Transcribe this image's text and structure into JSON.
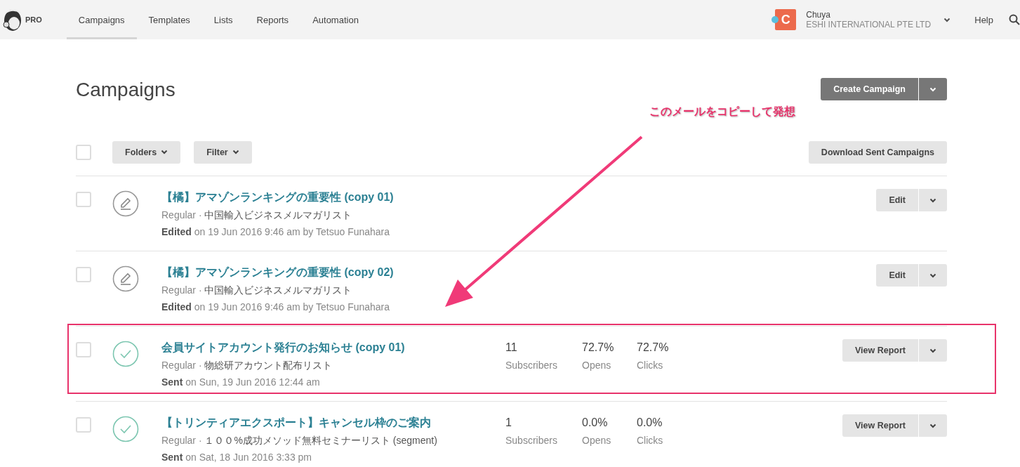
{
  "nav": {
    "badge": "PRO",
    "tabs": [
      {
        "label": "Campaigns",
        "selected": true
      },
      {
        "label": "Templates",
        "selected": false
      },
      {
        "label": "Lists",
        "selected": false
      },
      {
        "label": "Reports",
        "selected": false
      },
      {
        "label": "Automation",
        "selected": false
      }
    ],
    "account": {
      "initial": "C",
      "name": "Chuya",
      "company": "ESHI INTERNATIONAL PTE LTD"
    },
    "help": "Help"
  },
  "page": {
    "title": "Campaigns",
    "create_button": "Create Campaign",
    "select_all": {
      "checked": false
    },
    "folders": "Folders",
    "filter": "Filter",
    "download": "Download Sent Campaigns"
  },
  "campaigns": [
    {
      "kind": "draft",
      "checked": false,
      "highlighted": false,
      "title": "【橘】アマゾンランキングの重要性 (copy 01)",
      "type": "Regular ·",
      "list": "中国輸入ビジネスメルマガリスト",
      "status": "Edited",
      "detail": "on 19 Jun 2016 9:46 am by Tetsuo Funahara",
      "button": "Edit"
    },
    {
      "kind": "draft",
      "checked": false,
      "highlighted": false,
      "title": "【橘】アマゾンランキングの重要性 (copy 02)",
      "type": "Regular ·",
      "list": "中国輸入ビジネスメルマガリスト",
      "status": "Edited",
      "detail": "on 19 Jun 2016 9:46 am by Tetsuo Funahara",
      "button": "Edit"
    },
    {
      "kind": "sent",
      "checked": false,
      "highlighted": true,
      "title": "会員サイトアカウント発行のお知らせ (copy 01)",
      "type": "Regular ·",
      "list": "物総研アカウント配布リスト",
      "status": "Sent",
      "detail": "on Sun, 19 Jun 2016 12:44 am",
      "stats": [
        {
          "value": "11",
          "label": "Subscribers"
        },
        {
          "value": "72.7%",
          "label": "Opens"
        },
        {
          "value": "72.7%",
          "label": "Clicks"
        }
      ],
      "button": "View Report"
    },
    {
      "kind": "sent",
      "checked": false,
      "highlighted": false,
      "title": "【トリンティアエクスポート】キャンセル枠のご案内",
      "type": "Regular ·",
      "list": "１００%成功メソッド無料セミナーリスト (segment)",
      "status": "Sent",
      "detail": "on Sat, 18 Jun 2016 3:33 pm",
      "stats": [
        {
          "value": "1",
          "label": "Subscribers"
        },
        {
          "value": "0.0%",
          "label": "Opens"
        },
        {
          "value": "0.0%",
          "label": "Clicks"
        }
      ],
      "button": "View Report"
    }
  ],
  "annotation": {
    "text": "このメールをコピーして発想"
  }
}
